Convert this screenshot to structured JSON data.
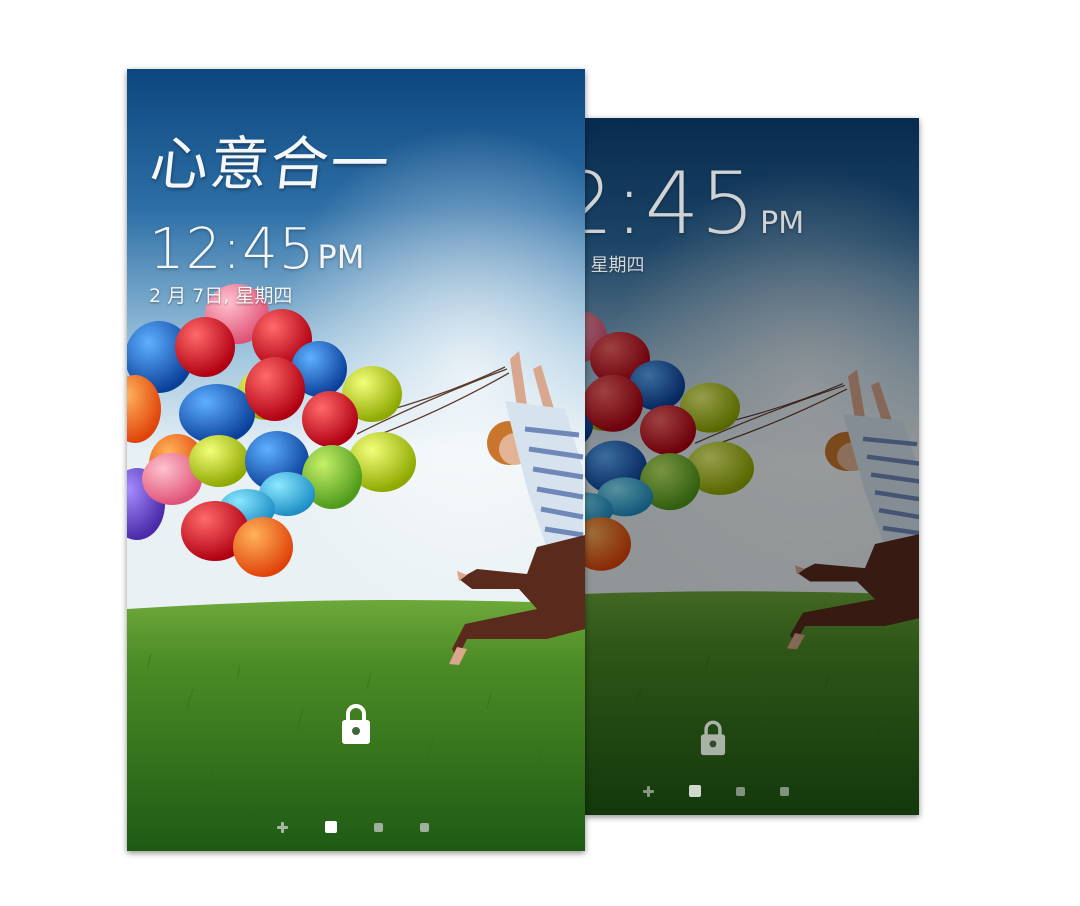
{
  "front_screen": {
    "calligraphy_title": "心意合一",
    "clock": {
      "time": "12:45",
      "ampm": "PM"
    },
    "date": "2 月 7日, 星期四"
  },
  "back_screen": {
    "clock": {
      "time": "2:45",
      "ampm": "PM"
    },
    "date": "日, 星期四"
  },
  "page_indicator": {
    "count": 4,
    "active_index": 1,
    "first_is_add": true
  },
  "icons": {
    "lock": "lock-icon",
    "add_page": "plus-icon"
  },
  "colors": {
    "sky_top": "#0f4d86",
    "sky_horizon": "#e8f1f6",
    "grass": "#3d7a1c",
    "text": "#f3f5f7"
  }
}
